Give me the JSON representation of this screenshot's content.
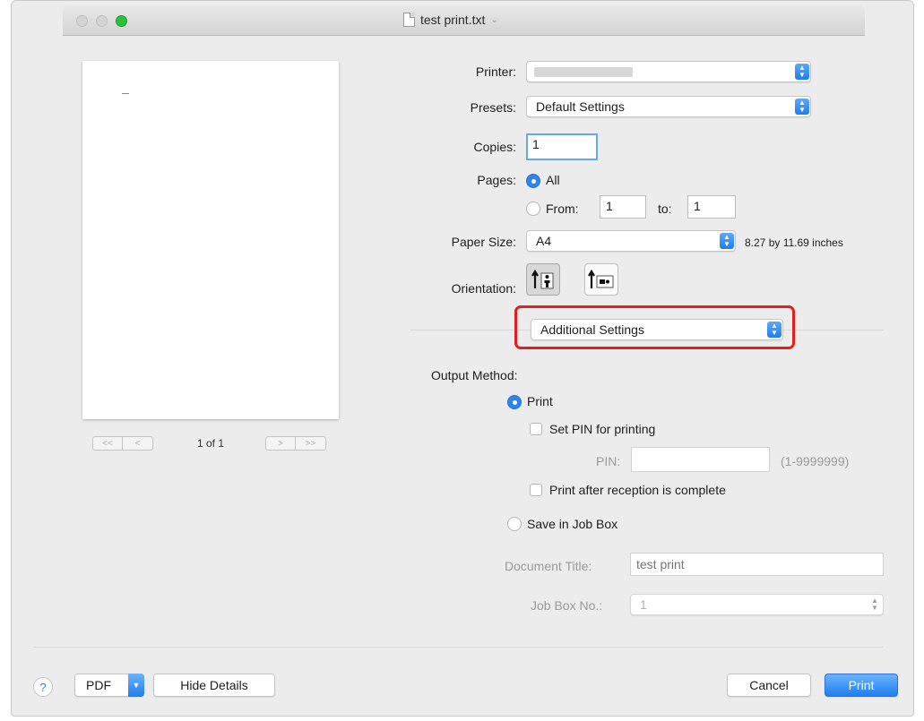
{
  "window": {
    "title": "test print.txt"
  },
  "preview": {
    "page_count": "1 of 1",
    "first_label": "<<",
    "prev_label": "<",
    "next_label": ">",
    "last_label": ">>"
  },
  "printer": {
    "label": "Printer:",
    "value": ""
  },
  "presets": {
    "label": "Presets:",
    "value": "Default Settings"
  },
  "copies": {
    "label": "Copies:",
    "value": "1"
  },
  "pages": {
    "label": "Pages:",
    "all_label": "All",
    "from_label": "From:",
    "from_value": "1",
    "to_label": "to:",
    "to_value": "1",
    "selected": "All"
  },
  "paper_size": {
    "label": "Paper Size:",
    "value": "A4",
    "dimensions": "8.27 by 11.69 inches"
  },
  "orientation": {
    "label": "Orientation:",
    "selected": "portrait"
  },
  "panel_menu": {
    "value": "Additional Settings"
  },
  "output_method": {
    "label": "Output Method:",
    "print_label": "Print",
    "set_pin_label": "Set PIN for printing",
    "pin_label": "PIN:",
    "pin_value": "",
    "pin_range": "(1-9999999)",
    "print_after_label": "Print after reception is complete",
    "save_job_box_label": "Save in Job Box",
    "document_title_label": "Document Title:",
    "document_title_placeholder": "test print",
    "job_box_label": "Job Box No.:",
    "job_box_value": "1",
    "selected": "Print"
  },
  "footer": {
    "help_label": "?",
    "pdf_label": "PDF",
    "hide_details_label": "Hide Details",
    "cancel_label": "Cancel",
    "print_label": "Print"
  },
  "colors": {
    "accent": "#2f83f1",
    "highlight": "#e41e1e"
  }
}
